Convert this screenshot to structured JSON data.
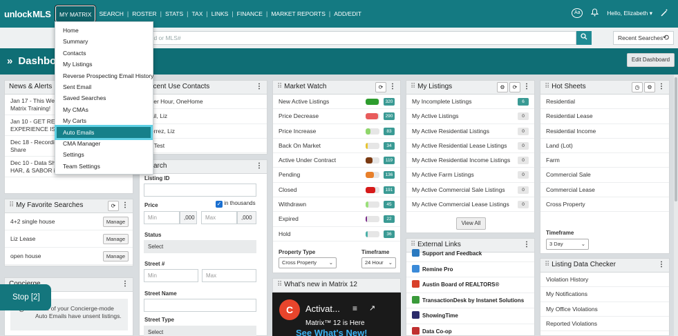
{
  "brand": {
    "logo_text_1": "unlock",
    "logo_text_2": "MLS"
  },
  "nav": {
    "items": [
      "MY MATRIX",
      "SEARCH",
      "ROSTER",
      "STATS",
      "TAX",
      "LINKS",
      "FINANCE",
      "MARKET REPORTS",
      "ADD/EDIT"
    ],
    "text_size_label": "Aa",
    "user_greeting": "Hello, Elizabeth"
  },
  "search": {
    "placeholder": "and or MLS#",
    "recent_label": "Recent Searches"
  },
  "dashboard": {
    "title": "Dashbo",
    "edit_label": "Edit Dashboard"
  },
  "dropdown": {
    "items": [
      "Home",
      "Summary",
      "Contacts",
      "My Listings",
      "Reverse Prospecting Email History",
      "Sent Email",
      "Saved Searches",
      "My CMAs",
      "My Carts",
      "Auto Emails",
      "CMA Manager",
      "Settings",
      "Team Settings"
    ],
    "highlighted": "Auto Emails"
  },
  "news": {
    "title": "News & Alerts",
    "items": [
      {
        "l1": "Jan 17 - This Week",
        "l2": "Matrix Training!"
      },
      {
        "l1": "Jan 10 - GET READ",
        "l2": "EXPERIENCE IS CO"
      },
      {
        "l1": "Dec 18 - Recording",
        "l2": "Share"
      },
      {
        "l1": "Dec 10 - Data Shar",
        "l2": "HAR, & SABOR is LIVE!"
      }
    ]
  },
  "recent_contacts": {
    "title": "ecent Use Contacts",
    "items": [
      "ver Hour, OneHome",
      "ail, Liz",
      "errez, Liz",
      ", Test"
    ]
  },
  "favorites": {
    "title": "My Favorite Searches",
    "manage_label": "Manage",
    "items": [
      "4+2 single house",
      "Liz Lease",
      "open house"
    ]
  },
  "concierge": {
    "title": "Concierge",
    "message_l1": "None of your Concierge-mode",
    "message_l2": "Auto Emails have unsent listings."
  },
  "stop": {
    "label": "Stop [2]"
  },
  "quick_search": {
    "title": "arch",
    "listing_id_label": "Listing ID",
    "price_label": "Price",
    "in_thousands_label": "in thousands",
    "min_placeholder": "Min",
    "max_placeholder": "Max",
    "thousands_suffix": ",000",
    "status_label": "Status",
    "select_label": "Select",
    "street_num_label": "Street #",
    "street_name_label": "Street Name",
    "street_type_label": "Street Type"
  },
  "market_watch": {
    "title": "Market Watch",
    "rows": [
      {
        "label": "New Active Listings",
        "count": "320",
        "fill": 0.95,
        "color": "#2e9d2e"
      },
      {
        "label": "Price Decrease",
        "count": "290",
        "fill": 0.9,
        "color": "#e85c5c"
      },
      {
        "label": "Price Increase",
        "count": "83",
        "fill": 0.35,
        "color": "#8fd66a"
      },
      {
        "label": "Back On Market",
        "count": "34",
        "fill": 0.15,
        "color": "#e6c430"
      },
      {
        "label": "Active Under Contract",
        "count": "119",
        "fill": 0.5,
        "color": "#7a3a12"
      },
      {
        "label": "Pending",
        "count": "136",
        "fill": 0.6,
        "color": "#e8802a"
      },
      {
        "label": "Closed",
        "count": "191",
        "fill": 0.7,
        "color": "#d61a1a"
      },
      {
        "label": "Withdrawn",
        "count": "45",
        "fill": 0.2,
        "color": "#9be07a"
      },
      {
        "label": "Expired",
        "count": "22",
        "fill": 0.1,
        "color": "#7a2a8a"
      },
      {
        "label": "Hold",
        "count": "36",
        "fill": 0.15,
        "color": "#4ab0a8"
      }
    ],
    "property_type_label": "Property Type",
    "property_type_value": "Cross Property",
    "timeframe_label": "Timeframe",
    "timeframe_value": "24 Hour"
  },
  "whats_new": {
    "title": "What's new in Matrix 12",
    "video_title": "Activat...",
    "video_sub": "Matrix™ 12 is Here",
    "video_sub2": "See What's New!"
  },
  "my_listings": {
    "title": "My Listings",
    "rows": [
      {
        "label": "My Incomplete Listings",
        "count": "6"
      },
      {
        "label": "My Active Listings",
        "count": "0"
      },
      {
        "label": "My Active Residential Listings",
        "count": "0"
      },
      {
        "label": "My Active Residential Lease Listings",
        "count": "0"
      },
      {
        "label": "My Active Residential Income Listings",
        "count": "0"
      },
      {
        "label": "My Active Farm Listings",
        "count": "0"
      },
      {
        "label": "My Active Commercial Sale Listings",
        "count": "0"
      },
      {
        "label": "My Active Commercial Lease Listings",
        "count": "0"
      }
    ],
    "view_all_label": "View All"
  },
  "external_links": {
    "title": "External Links",
    "items": [
      {
        "label": "Support and Feedback",
        "color": "#2a7ac0"
      },
      {
        "label": "Remine Pro",
        "color": "#3a8ad8"
      },
      {
        "label": "Austin Board of REALTORS®",
        "color": "#d8402a"
      },
      {
        "label": "TransactionDesk by Instanet Solutions",
        "color": "#3a9a3a"
      },
      {
        "label": "ShowingTime",
        "color": "#2a2a6a"
      },
      {
        "label": "Data Co-op",
        "color": "#c03030"
      }
    ]
  },
  "hot_sheets": {
    "title": "Hot Sheets",
    "items": [
      "Residential",
      "Residential Lease",
      "Residential Income",
      "Land (Lot)",
      "Farm",
      "Commercial Sale",
      "Commercial Lease",
      "Cross Property"
    ],
    "timeframe_label": "Timeframe",
    "timeframe_value": "3 Day"
  },
  "data_checker": {
    "title": "Listing Data Checker",
    "items": [
      "Violation History",
      "My Notifications",
      "My Office Violations",
      "Reported Violations"
    ]
  },
  "colors": {
    "primary": "#147a82",
    "dark": "#0f6e75",
    "highlight_outline": "#5fd0e4"
  }
}
